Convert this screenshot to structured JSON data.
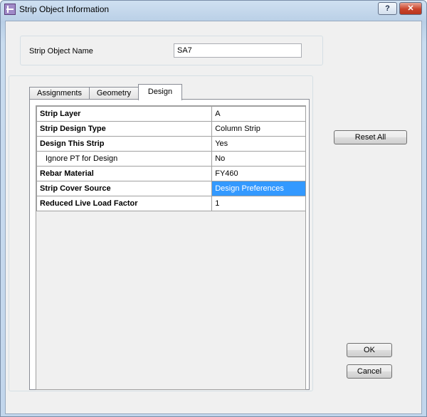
{
  "window": {
    "title": "Strip Object Information",
    "help_label": "?",
    "close_label": "✕"
  },
  "name_group": {
    "label": "Strip Object Name",
    "value": "SA7"
  },
  "tabs": [
    {
      "label": "Assignments",
      "active": false
    },
    {
      "label": "Geometry",
      "active": false
    },
    {
      "label": "Design",
      "active": true
    }
  ],
  "properties": [
    {
      "key": "Strip Layer",
      "value": "A"
    },
    {
      "key": "Strip Design Type",
      "value": "Column Strip"
    },
    {
      "key": "Design This Strip",
      "value": "Yes"
    },
    {
      "key": "Ignore PT for Design",
      "value": "No"
    },
    {
      "key": "Rebar Material",
      "value": "FY460"
    },
    {
      "key": "Strip Cover Source",
      "value": "Design Preferences"
    },
    {
      "key": "Reduced Live Load Factor",
      "value": "1"
    }
  ],
  "buttons": {
    "reset_all": "Reset All",
    "ok": "OK",
    "cancel": "Cancel"
  },
  "colors": {
    "selection": "#3399ff",
    "close_button": "#c9432a"
  }
}
